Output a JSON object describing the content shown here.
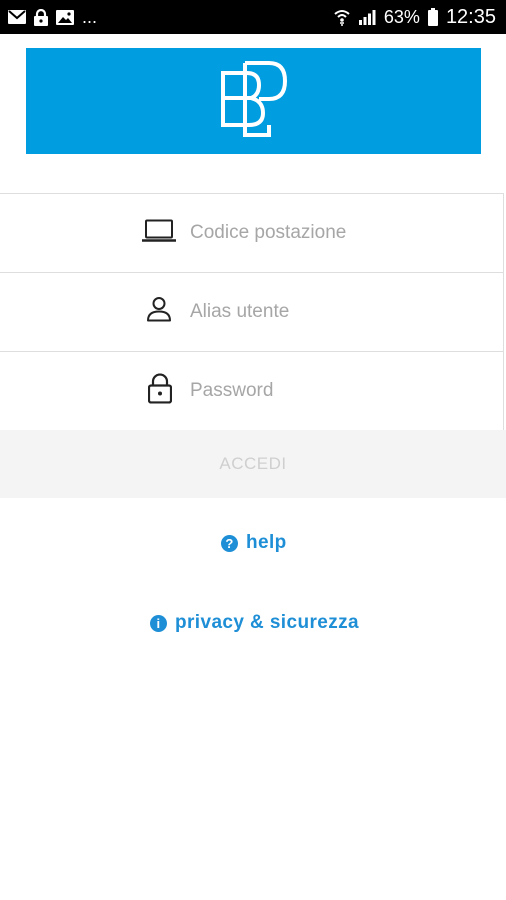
{
  "status_bar": {
    "battery": "63%",
    "time": "12:35",
    "more": "..."
  },
  "banner": {
    "logo_icon": "bp-logo",
    "color": "#009de0"
  },
  "form": {
    "workstation": {
      "placeholder": "Codice postazione",
      "icon": "laptop-icon"
    },
    "alias": {
      "placeholder": "Alias utente",
      "icon": "user-icon"
    },
    "password": {
      "placeholder": "Password",
      "icon": "lock-icon"
    }
  },
  "login_button": {
    "label": "ACCEDI"
  },
  "links": {
    "help": {
      "label": "help",
      "icon": "question-icon",
      "glyph": "?"
    },
    "privacy": {
      "label": "privacy & sicurezza",
      "icon": "info-icon",
      "glyph": "i"
    }
  },
  "colors": {
    "accent": "#1e8fd6",
    "banner": "#009de0"
  }
}
